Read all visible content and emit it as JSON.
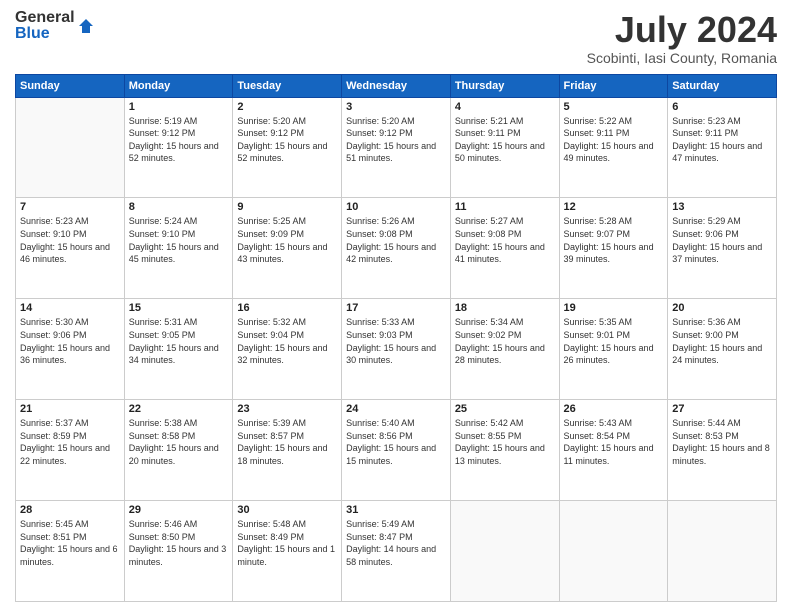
{
  "header": {
    "logo_general": "General",
    "logo_blue": "Blue",
    "month_title": "July 2024",
    "location": "Scobinti, Iasi County, Romania"
  },
  "days_of_week": [
    "Sunday",
    "Monday",
    "Tuesday",
    "Wednesday",
    "Thursday",
    "Friday",
    "Saturday"
  ],
  "weeks": [
    [
      {
        "day": "",
        "sunrise": "",
        "sunset": "",
        "daylight": ""
      },
      {
        "day": "1",
        "sunrise": "5:19 AM",
        "sunset": "9:12 PM",
        "daylight": "15 hours and 52 minutes."
      },
      {
        "day": "2",
        "sunrise": "5:20 AM",
        "sunset": "9:12 PM",
        "daylight": "15 hours and 52 minutes."
      },
      {
        "day": "3",
        "sunrise": "5:20 AM",
        "sunset": "9:12 PM",
        "daylight": "15 hours and 51 minutes."
      },
      {
        "day": "4",
        "sunrise": "5:21 AM",
        "sunset": "9:11 PM",
        "daylight": "15 hours and 50 minutes."
      },
      {
        "day": "5",
        "sunrise": "5:22 AM",
        "sunset": "9:11 PM",
        "daylight": "15 hours and 49 minutes."
      },
      {
        "day": "6",
        "sunrise": "5:23 AM",
        "sunset": "9:11 PM",
        "daylight": "15 hours and 47 minutes."
      }
    ],
    [
      {
        "day": "7",
        "sunrise": "5:23 AM",
        "sunset": "9:10 PM",
        "daylight": "15 hours and 46 minutes."
      },
      {
        "day": "8",
        "sunrise": "5:24 AM",
        "sunset": "9:10 PM",
        "daylight": "15 hours and 45 minutes."
      },
      {
        "day": "9",
        "sunrise": "5:25 AM",
        "sunset": "9:09 PM",
        "daylight": "15 hours and 43 minutes."
      },
      {
        "day": "10",
        "sunrise": "5:26 AM",
        "sunset": "9:08 PM",
        "daylight": "15 hours and 42 minutes."
      },
      {
        "day": "11",
        "sunrise": "5:27 AM",
        "sunset": "9:08 PM",
        "daylight": "15 hours and 41 minutes."
      },
      {
        "day": "12",
        "sunrise": "5:28 AM",
        "sunset": "9:07 PM",
        "daylight": "15 hours and 39 minutes."
      },
      {
        "day": "13",
        "sunrise": "5:29 AM",
        "sunset": "9:06 PM",
        "daylight": "15 hours and 37 minutes."
      }
    ],
    [
      {
        "day": "14",
        "sunrise": "5:30 AM",
        "sunset": "9:06 PM",
        "daylight": "15 hours and 36 minutes."
      },
      {
        "day": "15",
        "sunrise": "5:31 AM",
        "sunset": "9:05 PM",
        "daylight": "15 hours and 34 minutes."
      },
      {
        "day": "16",
        "sunrise": "5:32 AM",
        "sunset": "9:04 PM",
        "daylight": "15 hours and 32 minutes."
      },
      {
        "day": "17",
        "sunrise": "5:33 AM",
        "sunset": "9:03 PM",
        "daylight": "15 hours and 30 minutes."
      },
      {
        "day": "18",
        "sunrise": "5:34 AM",
        "sunset": "9:02 PM",
        "daylight": "15 hours and 28 minutes."
      },
      {
        "day": "19",
        "sunrise": "5:35 AM",
        "sunset": "9:01 PM",
        "daylight": "15 hours and 26 minutes."
      },
      {
        "day": "20",
        "sunrise": "5:36 AM",
        "sunset": "9:00 PM",
        "daylight": "15 hours and 24 minutes."
      }
    ],
    [
      {
        "day": "21",
        "sunrise": "5:37 AM",
        "sunset": "8:59 PM",
        "daylight": "15 hours and 22 minutes."
      },
      {
        "day": "22",
        "sunrise": "5:38 AM",
        "sunset": "8:58 PM",
        "daylight": "15 hours and 20 minutes."
      },
      {
        "day": "23",
        "sunrise": "5:39 AM",
        "sunset": "8:57 PM",
        "daylight": "15 hours and 18 minutes."
      },
      {
        "day": "24",
        "sunrise": "5:40 AM",
        "sunset": "8:56 PM",
        "daylight": "15 hours and 15 minutes."
      },
      {
        "day": "25",
        "sunrise": "5:42 AM",
        "sunset": "8:55 PM",
        "daylight": "15 hours and 13 minutes."
      },
      {
        "day": "26",
        "sunrise": "5:43 AM",
        "sunset": "8:54 PM",
        "daylight": "15 hours and 11 minutes."
      },
      {
        "day": "27",
        "sunrise": "5:44 AM",
        "sunset": "8:53 PM",
        "daylight": "15 hours and 8 minutes."
      }
    ],
    [
      {
        "day": "28",
        "sunrise": "5:45 AM",
        "sunset": "8:51 PM",
        "daylight": "15 hours and 6 minutes."
      },
      {
        "day": "29",
        "sunrise": "5:46 AM",
        "sunset": "8:50 PM",
        "daylight": "15 hours and 3 minutes."
      },
      {
        "day": "30",
        "sunrise": "5:48 AM",
        "sunset": "8:49 PM",
        "daylight": "15 hours and 1 minute."
      },
      {
        "day": "31",
        "sunrise": "5:49 AM",
        "sunset": "8:47 PM",
        "daylight": "14 hours and 58 minutes."
      },
      {
        "day": "",
        "sunrise": "",
        "sunset": "",
        "daylight": ""
      },
      {
        "day": "",
        "sunrise": "",
        "sunset": "",
        "daylight": ""
      },
      {
        "day": "",
        "sunrise": "",
        "sunset": "",
        "daylight": ""
      }
    ]
  ],
  "labels": {
    "sunrise": "Sunrise:",
    "sunset": "Sunset:",
    "daylight": "Daylight:"
  }
}
